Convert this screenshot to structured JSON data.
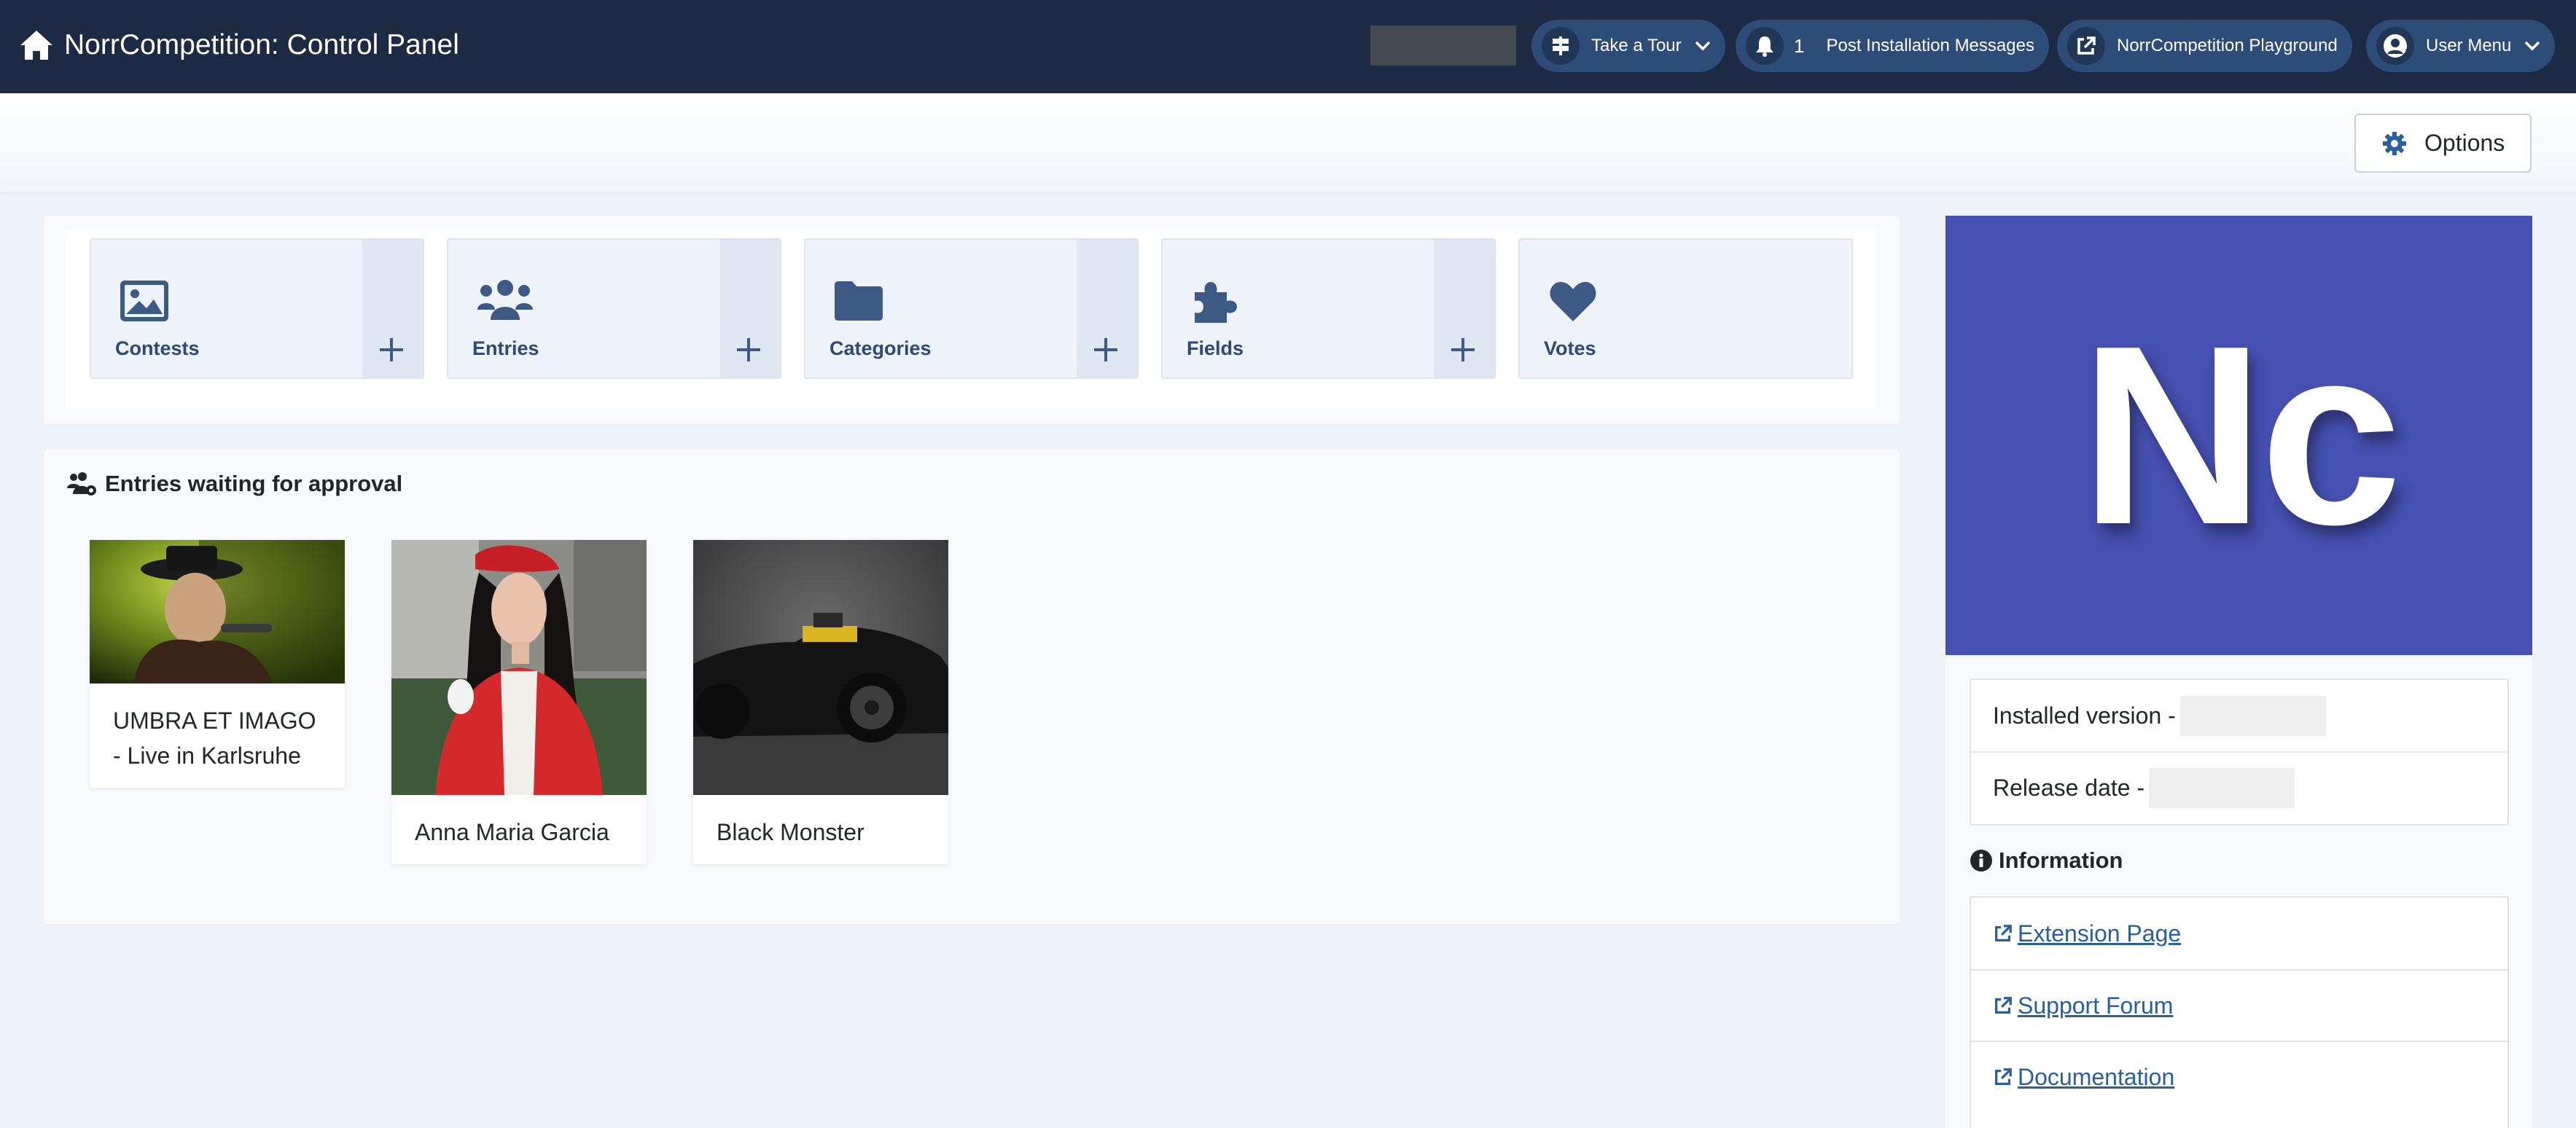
{
  "header": {
    "title": "NorrCompetition: Control Panel",
    "tour_label": "Take a Tour",
    "notif_count": "1",
    "post_install_label": "Post Installation Messages",
    "playground_label": "NorrCompetition Playground",
    "user_menu_label": "User Menu"
  },
  "toolbar": {
    "options_label": "Options"
  },
  "quick_icons": [
    {
      "label": "Contests",
      "icon": "image-icon"
    },
    {
      "label": "Entries",
      "icon": "users-icon"
    },
    {
      "label": "Categories",
      "icon": "folder-icon"
    },
    {
      "label": "Fields",
      "icon": "puzzle-icon"
    },
    {
      "label": "Votes",
      "icon": "heart-icon"
    }
  ],
  "approval": {
    "title": "Entries waiting for approval",
    "entries": [
      {
        "name": "UMBRA ET IMAGO - Live in Karlsruhe"
      },
      {
        "name": "Anna Maria Garcia"
      },
      {
        "name": "Black Monster"
      }
    ]
  },
  "logo": {
    "text": "Nc"
  },
  "version": {
    "installed_label": "Installed version -",
    "release_label": "Release date -"
  },
  "info": {
    "title": "Information",
    "links": [
      "Extension Page",
      "Support Forum",
      "Documentation"
    ]
  },
  "colors": {
    "header_bg": "#1c2a43",
    "pill_bg": "#2e4c78",
    "logo_bg": "#4550b0",
    "link": "#2a5f9e",
    "icon": "#3d5a84"
  }
}
